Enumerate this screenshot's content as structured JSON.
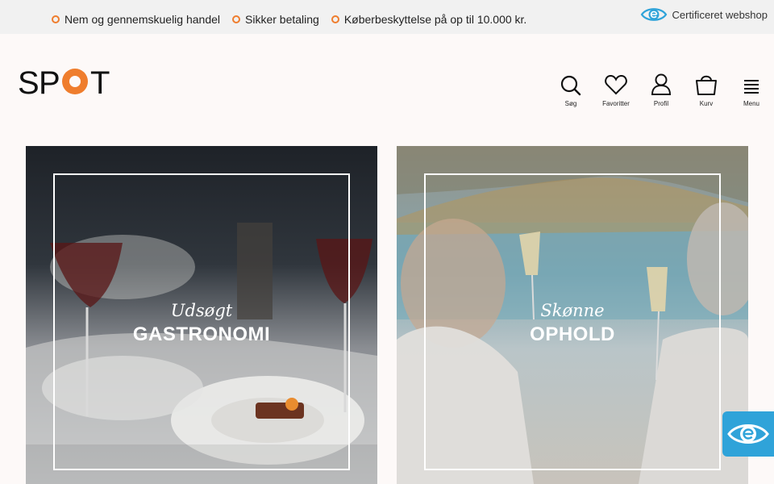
{
  "topbar": {
    "usps": [
      "Nem og gennemskuelig handel",
      "Sikker betaling",
      "Køberbeskyttelse på op til 10.000 kr."
    ],
    "certificate": "Certificeret webshop"
  },
  "brand": {
    "logo_text": "SPOT",
    "accent_color": "#ef7d2d"
  },
  "nav": {
    "search": "Søg",
    "favorites": "Favoritter",
    "profile": "Profil",
    "cart": "Kurv",
    "menu": "Menu"
  },
  "cards": [
    {
      "script": "Udsøgt",
      "title": "GASTRONOMI"
    },
    {
      "script": "Skønne",
      "title": "OPHOLD"
    }
  ],
  "colors": {
    "topbar_bg": "#f1f1f1",
    "page_bg": "#fdf9f8",
    "badge_blue": "#2fa3d9"
  }
}
